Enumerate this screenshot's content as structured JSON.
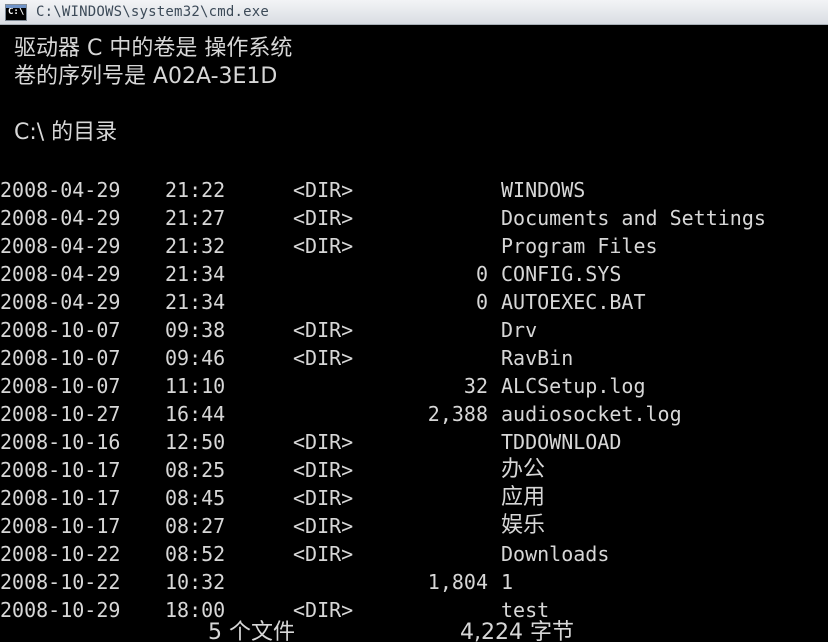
{
  "window": {
    "title": "C:\\WINDOWS\\system32\\cmd.exe",
    "icon": "cmd-icon"
  },
  "console": {
    "header": {
      "drive_line": "驱动器 C 中的卷是 操作系统",
      "serial_line": "卷的序列号是 A02A-3E1D",
      "dir_of": "C:\\ 的目录"
    },
    "entries": [
      {
        "date": "2008-04-29",
        "time": "21:22",
        "dir": "<DIR>",
        "size": "",
        "name": "WINDOWS"
      },
      {
        "date": "2008-04-29",
        "time": "21:27",
        "dir": "<DIR>",
        "size": "",
        "name": "Documents and Settings"
      },
      {
        "date": "2008-04-29",
        "time": "21:32",
        "dir": "<DIR>",
        "size": "",
        "name": "Program Files"
      },
      {
        "date": "2008-04-29",
        "time": "21:34",
        "dir": "",
        "size": "0",
        "name": "CONFIG.SYS"
      },
      {
        "date": "2008-04-29",
        "time": "21:34",
        "dir": "",
        "size": "0",
        "name": "AUTOEXEC.BAT"
      },
      {
        "date": "2008-10-07",
        "time": "09:38",
        "dir": "<DIR>",
        "size": "",
        "name": "Drv"
      },
      {
        "date": "2008-10-07",
        "time": "09:46",
        "dir": "<DIR>",
        "size": "",
        "name": "RavBin"
      },
      {
        "date": "2008-10-07",
        "time": "11:10",
        "dir": "",
        "size": "32",
        "name": "ALCSetup.log"
      },
      {
        "date": "2008-10-27",
        "time": "16:44",
        "dir": "",
        "size": "2,388",
        "name": "audiosocket.log"
      },
      {
        "date": "2008-10-16",
        "time": "12:50",
        "dir": "<DIR>",
        "size": "",
        "name": "TDDOWNLOAD"
      },
      {
        "date": "2008-10-17",
        "time": "08:25",
        "dir": "<DIR>",
        "size": "",
        "name": "办公"
      },
      {
        "date": "2008-10-17",
        "time": "08:45",
        "dir": "<DIR>",
        "size": "",
        "name": "应用"
      },
      {
        "date": "2008-10-17",
        "time": "08:27",
        "dir": "<DIR>",
        "size": "",
        "name": "娱乐"
      },
      {
        "date": "2008-10-22",
        "time": "08:52",
        "dir": "<DIR>",
        "size": "",
        "name": "Downloads"
      },
      {
        "date": "2008-10-22",
        "time": "10:32",
        "dir": "",
        "size": "1,804",
        "name": "1"
      },
      {
        "date": "2008-10-29",
        "time": "18:00",
        "dir": "<DIR>",
        "size": "",
        "name": "test"
      }
    ],
    "summary": {
      "files_count": "5 个文件",
      "bytes": "4,224 字节"
    }
  },
  "colors": {
    "background": "#000000",
    "text": "#d7d7d7",
    "titlebar": "#e6e9ee"
  }
}
